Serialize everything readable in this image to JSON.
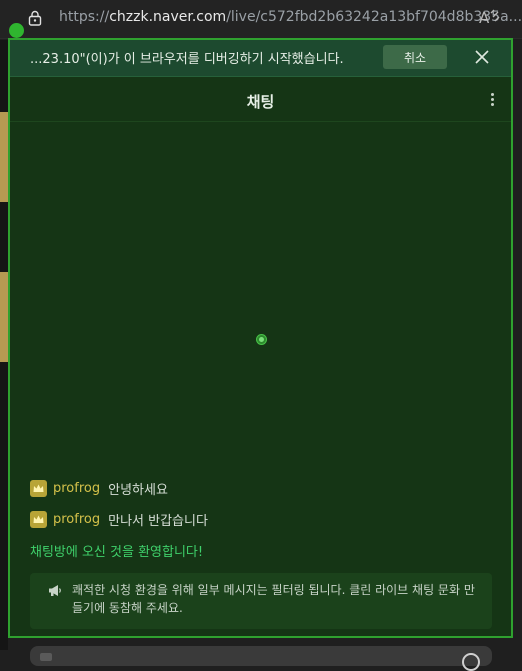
{
  "browser": {
    "url_prefix": "https://",
    "url_domain": "chzzk.naver.com",
    "url_path": "/live/c572fbd2b63242a13bf704d8b335a..."
  },
  "debug_bar": {
    "message": "...23.10\"(이)가 이 브라우저를 디버깅하기 시작했습니다.",
    "cancel_label": "취소"
  },
  "chat": {
    "title": "채팅",
    "messages": [
      {
        "nickname": "profrog",
        "text": "안녕하세요"
      },
      {
        "nickname": "profrog",
        "text": "만나서 반갑습니다"
      }
    ],
    "welcome": "채팅방에 오신 것을 환영합니다!",
    "notice": "쾌적한 시청 환경을 위해 일부 메시지는 필터링 됩니다. 클린 라이브 채팅 문화 만들기에 동참해 주세요."
  },
  "colors": {
    "panel_bg": "#153515",
    "panel_border": "#2fa12f",
    "nickname": "#d4c14a",
    "welcome": "#3fd16b"
  },
  "icons": [
    "lock-icon",
    "reader-mode-icon",
    "close-icon",
    "more-icon",
    "crown-icon",
    "megaphone-icon"
  ]
}
